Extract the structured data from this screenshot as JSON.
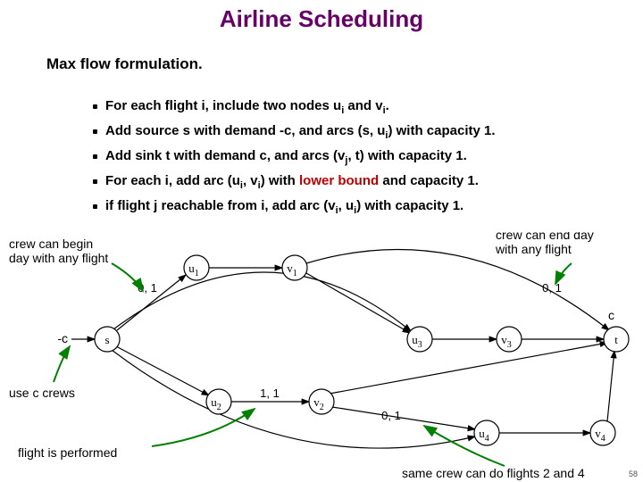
{
  "title": "Airline Scheduling",
  "subhead": "Max flow formulation.",
  "bullets": [
    {
      "pre": "For each flight i, include two nodes u",
      "sub1": "i",
      "mid": " and v",
      "sub2": "i",
      "post": "."
    },
    {
      "pre": "Add source s with demand -c, and arcs (s, u",
      "sub1": "i",
      "mid": ") with capacity 1.",
      "sub2": "",
      "post": ""
    },
    {
      "pre": "Add sink t with demand c, and arcs (v",
      "sub1": "j",
      "mid": ", t) with capacity 1.",
      "sub2": "",
      "post": ""
    },
    {
      "pre": "For each i, add arc (u",
      "sub1": "i",
      "mid": ", v",
      "sub2": "i",
      "post": ") with ",
      "red": "lower bound",
      "tail": " and capacity 1."
    },
    {
      "pre": "if flight j reachable from i, add arc (v",
      "sub1": "i",
      "mid": ", u",
      "sub2": "i",
      "post": ") with capacity 1."
    }
  ],
  "annotations": {
    "crew_begin": "crew can begin\nday with any flight",
    "crew_end": "crew can end day\nwith any flight",
    "use_crews": "use c crews",
    "flight_performed": "flight is performed",
    "same_crew": "same crew can do flights 2 and 4"
  },
  "nodes": {
    "s": "s",
    "t": "t",
    "c": "c",
    "mc": "-c",
    "u1": "u",
    "u1s": "1",
    "v1": "v",
    "v1s": "1",
    "u2": "u",
    "u2s": "2",
    "v2": "v",
    "v2s": "2",
    "u3": "u",
    "u3s": "3",
    "v3": "v",
    "v3s": "3",
    "u4": "u",
    "u4s": "4",
    "v4": "v",
    "v4s": "4"
  },
  "edge_labels": {
    "zero_one": "0, 1",
    "one_one": "1, 1"
  },
  "page_number": "58"
}
